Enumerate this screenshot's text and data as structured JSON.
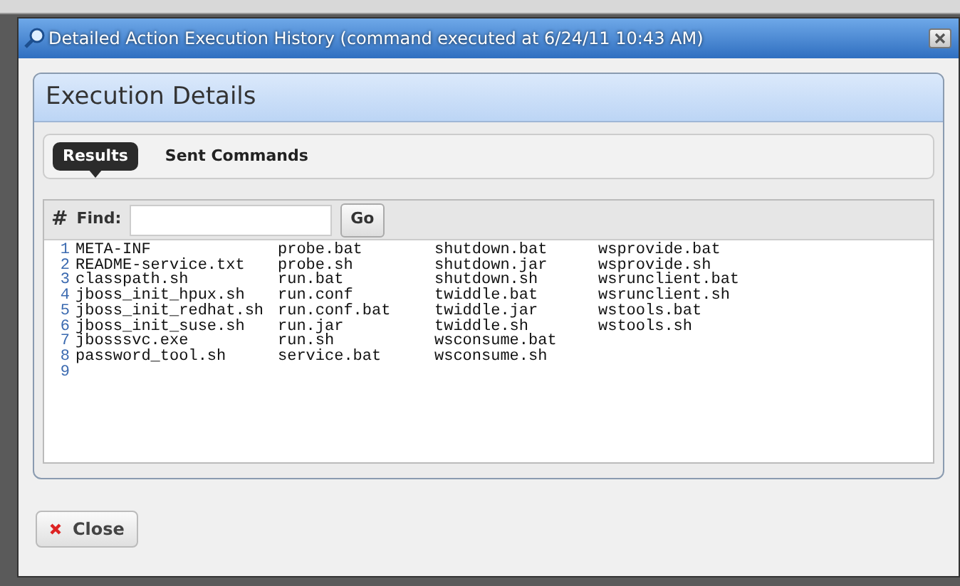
{
  "dialog": {
    "title": "Detailed Action Execution History (command executed at 6/24/11 10:43 AM)"
  },
  "panel": {
    "title": "Execution Details"
  },
  "tabs": [
    {
      "label": "Results",
      "selected": true
    },
    {
      "label": "Sent Commands",
      "selected": false
    }
  ],
  "find_bar": {
    "hash": "#",
    "label": "Find:",
    "button": "Go"
  },
  "output_lines": [
    {
      "number": "1",
      "files": [
        "META-INF",
        "probe.bat",
        "shutdown.bat",
        "wsprovide.bat"
      ]
    },
    {
      "number": "2",
      "files": [
        "README-service.txt",
        "probe.sh",
        "shutdown.jar",
        "wsprovide.sh"
      ]
    },
    {
      "number": "3",
      "files": [
        "classpath.sh",
        "run.bat",
        "shutdown.sh",
        "wsrunclient.bat"
      ]
    },
    {
      "number": "4",
      "files": [
        "jboss_init_hpux.sh",
        "run.conf",
        "twiddle.bat",
        "wsrunclient.sh"
      ]
    },
    {
      "number": "5",
      "files": [
        "jboss_init_redhat.sh",
        "run.conf.bat",
        "twiddle.jar",
        "wstools.bat"
      ]
    },
    {
      "number": "6",
      "files": [
        "jboss_init_suse.sh",
        "run.jar",
        "twiddle.sh",
        "wstools.sh"
      ]
    },
    {
      "number": "7",
      "files": [
        "jbosssvc.exe",
        "run.sh",
        "wsconsume.bat"
      ]
    },
    {
      "number": "8",
      "files": [
        "password_tool.sh",
        "service.bat",
        "wsconsume.sh"
      ]
    },
    {
      "number": "9"
    }
  ],
  "buttons": [
    {
      "label": "Close"
    }
  ]
}
